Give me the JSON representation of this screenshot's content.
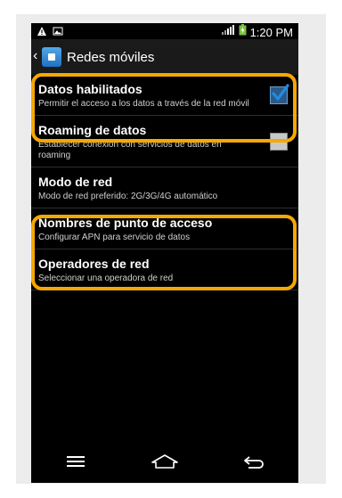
{
  "status_bar": {
    "time": "1:20 PM",
    "icons": [
      "warning-icon",
      "image-icon",
      "signal-icon",
      "battery-icon"
    ]
  },
  "action_bar": {
    "title": "Redes móviles",
    "icon": "mobile-networks-icon"
  },
  "settings": [
    {
      "title": "Datos habilitados",
      "summary": "Permitir el acceso a los datos a través de la red móvil",
      "checkbox": true,
      "checked": true
    },
    {
      "title": "Roaming de datos",
      "summary": "Establecer conexión con servicios de datos en roaming",
      "checkbox": true,
      "checked": false
    },
    {
      "title": "Modo de red",
      "summary": "Modo de red preferido: 2G/3G/4G automático",
      "checkbox": false
    },
    {
      "title": "Nombres de punto de acceso",
      "summary": "Configurar APN para servicio de datos",
      "checkbox": false
    },
    {
      "title": "Operadores de red",
      "summary": "Seleccionar una operadora de red",
      "checkbox": false
    }
  ],
  "nav_bar": [
    "menu-icon",
    "home-icon",
    "back-icon"
  ],
  "colors": {
    "highlight": "#f6a800",
    "accent": "#2b5a8a"
  }
}
